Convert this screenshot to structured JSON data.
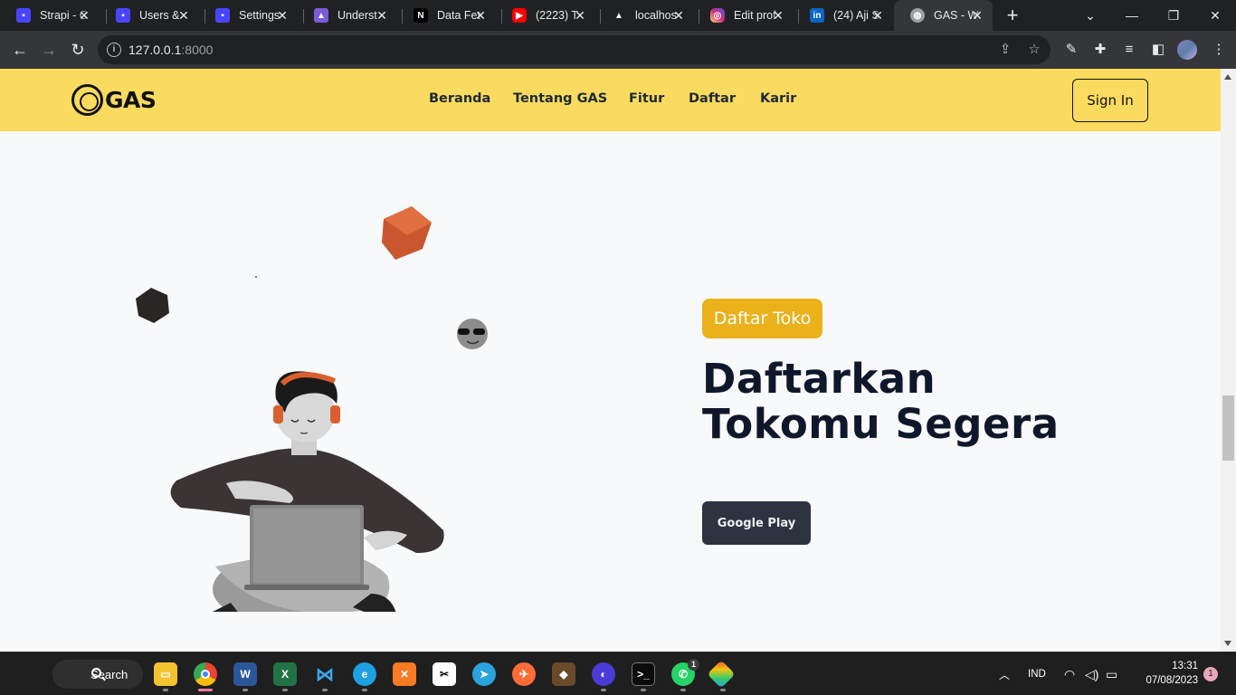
{
  "browser": {
    "tabs": [
      {
        "title": "Strapi - C",
        "favicon": "strapi-icon",
        "color": "#4945ff"
      },
      {
        "title": "Users &",
        "favicon": "strapi-icon",
        "color": "#4945ff"
      },
      {
        "title": "Settings",
        "favicon": "strapi-icon",
        "color": "#4945ff"
      },
      {
        "title": "Underst",
        "favicon": "rocket-icon",
        "color": "#7b5cd6"
      },
      {
        "title": "Data Fet",
        "favicon": "nextjs-icon",
        "color": "#000000"
      },
      {
        "title": "(2223) T",
        "favicon": "youtube-icon",
        "color": "#ff0000"
      },
      {
        "title": "localhos",
        "favicon": "vercel-icon",
        "color": "#000000"
      },
      {
        "title": "Edit prof",
        "favicon": "instagram-icon",
        "color": "#d62976"
      },
      {
        "title": "(24) Aji S",
        "favicon": "linkedin-icon",
        "color": "#0a66c2"
      },
      {
        "title": "GAS - W",
        "favicon": "globe-icon",
        "color": "#9aa0a6",
        "active": true
      }
    ],
    "url_host": "127.0.0.1",
    "url_port": ":8000"
  },
  "site": {
    "logo_text": "GAS",
    "menu": [
      "Beranda",
      "Tentang GAS",
      "Fitur",
      "Daftar",
      "Karir"
    ],
    "signin_label": "Sign In",
    "badge": "Daftar Toko",
    "title_line1": "Daftarkan",
    "title_line2": "Tokomu Segera",
    "cta_label": "Google Play",
    "colors": {
      "nav": "#fadb5f",
      "badge": "#ebb11a",
      "title": "#0f172a",
      "cta": "#2d3340"
    }
  },
  "taskbar": {
    "search_label": "Search",
    "language": "IND",
    "time": "13:31",
    "date": "07/08/2023",
    "notifications": "1",
    "whatsapp_badge": "1"
  }
}
